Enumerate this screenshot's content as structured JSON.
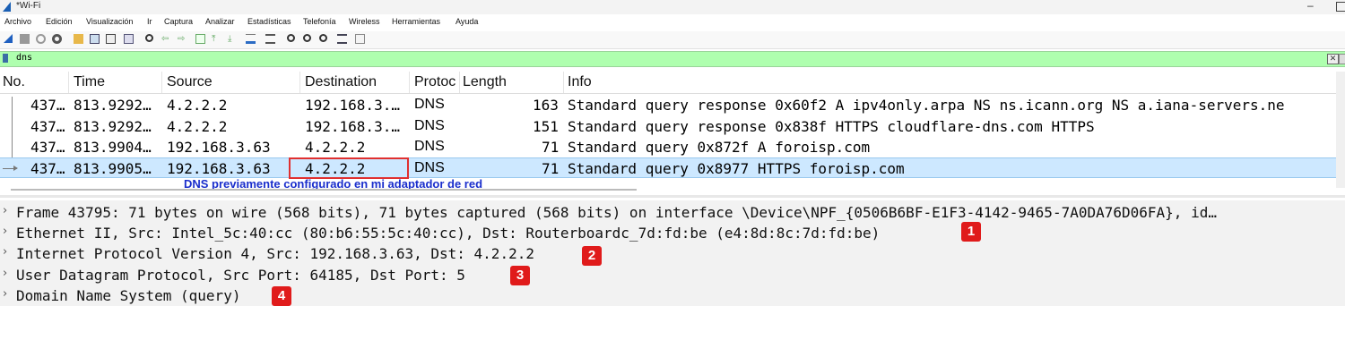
{
  "window": {
    "title": "*Wi-Fi",
    "minimize": "–"
  },
  "menu": [
    "Archivo",
    "Edición",
    "Visualización",
    "Ir",
    "Captura",
    "Analizar",
    "Estadísticas",
    "Telefonía",
    "Wireless",
    "Herramientas",
    "Ayuda"
  ],
  "toolbar": {
    "icons": [
      "shark-fin-start-icon",
      "stop-icon",
      "restart-icon",
      "capture-options-icon",
      "open-file-icon",
      "save-file-icon",
      "close-file-icon",
      "reload-icon",
      "find-icon",
      "go-back-icon",
      "go-forward-icon",
      "go-to-packet-icon",
      "go-first-icon",
      "go-last-icon",
      "autoscroll-icon",
      "colorize-icon",
      "zoom-in-icon",
      "zoom-out-icon",
      "zoom-reset-icon",
      "resize-columns-icon",
      "layout-icon"
    ]
  },
  "filter": {
    "value": "dns",
    "clear_label": "✕"
  },
  "packet_list": {
    "columns": [
      "No.",
      "Time",
      "Source",
      "Destination",
      "Protoc",
      "Length",
      "Info"
    ],
    "rows": [
      {
        "no": "437…",
        "time": "813.9292…",
        "source": "4.2.2.2",
        "destination": "192.168.3.…",
        "protocol": "DNS",
        "length": "163",
        "info": "Standard query response 0x60f2 A ipv4only.arpa NS ns.icann.org NS a.iana-servers.ne"
      },
      {
        "no": "437…",
        "time": "813.9292…",
        "source": "4.2.2.2",
        "destination": "192.168.3.…",
        "protocol": "DNS",
        "length": "151",
        "info": "Standard query response 0x838f HTTPS cloudflare-dns.com HTTPS"
      },
      {
        "no": "437…",
        "time": "813.9904…",
        "source": "192.168.3.63",
        "destination": "4.2.2.2",
        "protocol": "DNS",
        "length": "71",
        "info": "Standard query 0x872f A foroisp.com"
      },
      {
        "no": "437…",
        "time": "813.9905…",
        "source": "192.168.3.63",
        "destination": "4.2.2.2",
        "protocol": "DNS",
        "length": "71",
        "info": "Standard query 0x8977 HTTPS foroisp.com"
      }
    ]
  },
  "annotation": "DNS previamente configurado en mi adaptador de red",
  "details": [
    "Frame 43795: 71 bytes on wire (568 bits), 71 bytes captured (568 bits) on interface \\Device\\NPF_{0506B6BF-E1F3-4142-9465-7A0DA76D06FA}, id…",
    "Ethernet II, Src: Intel_5c:40:cc (80:b6:55:5c:40:cc), Dst: Routerboardc_7d:fd:be (e4:8d:8c:7d:fd:be)",
    "Internet Protocol Version 4, Src: 192.168.3.63, Dst: 4.2.2.2",
    "User Datagram Protocol, Src Port: 64185, Dst Port: 5",
    "Domain Name System (query)"
  ],
  "detail_chevron": "›",
  "badges": [
    "1",
    "2",
    "3",
    "4"
  ],
  "colors": {
    "filter_ok": "#afffaf",
    "selected_row": "#cde8ff",
    "badge": "#e01b1b",
    "annotation": "#1a2ecc"
  }
}
